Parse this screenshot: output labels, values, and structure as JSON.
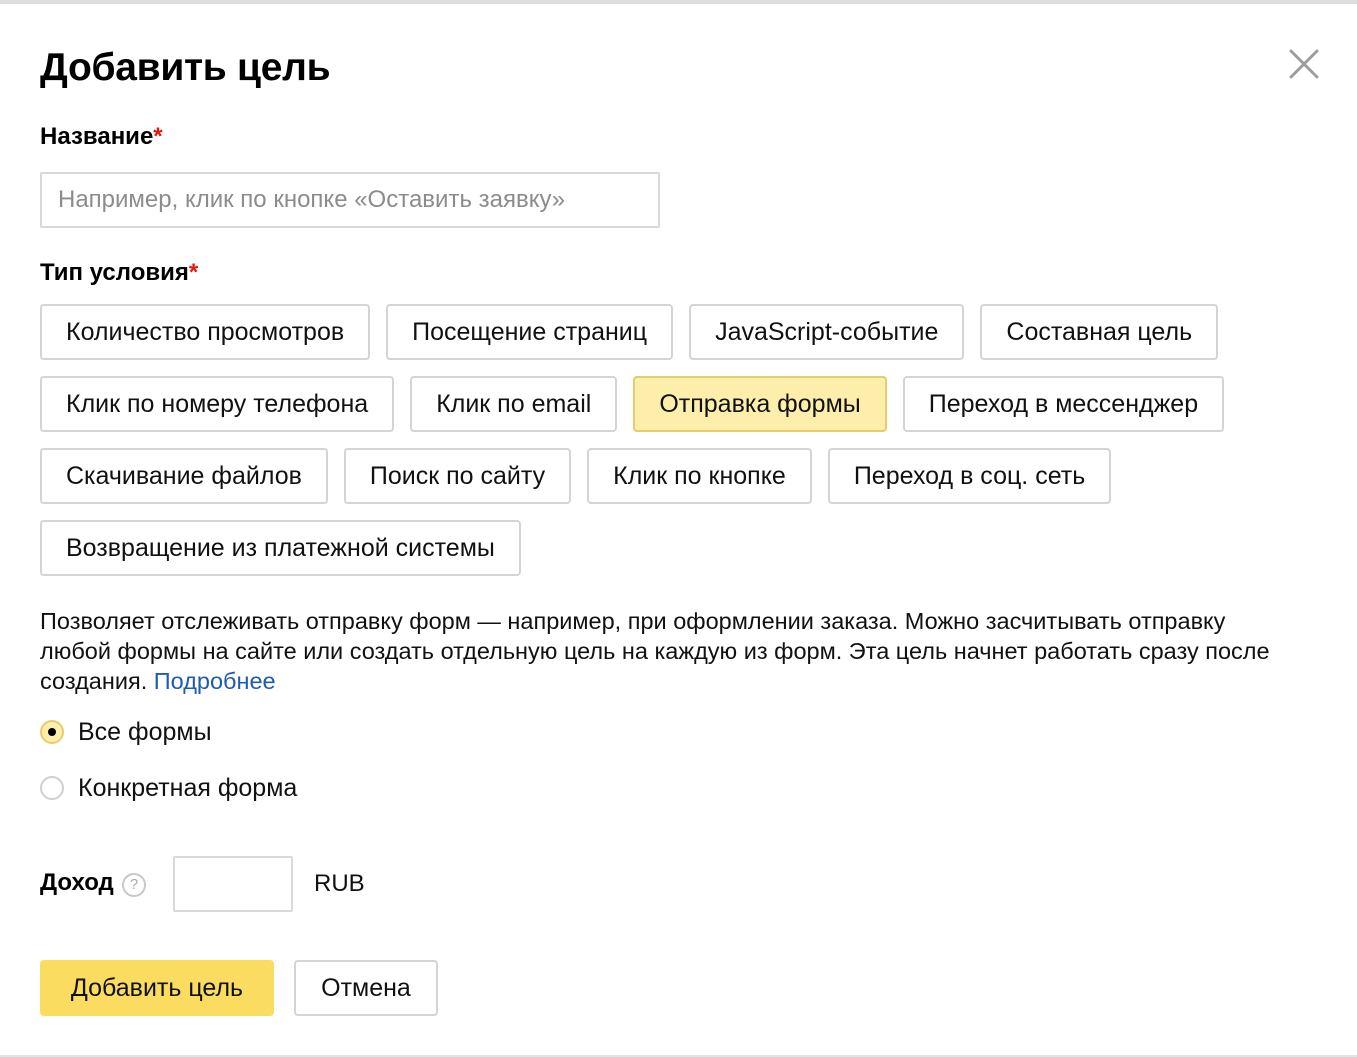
{
  "dialog": {
    "title": "Добавить цель",
    "close_icon": "close-icon"
  },
  "name_field": {
    "label": "Название",
    "required_mark": "*",
    "value": "",
    "placeholder": "Например, клик по кнопке «Оставить заявку»"
  },
  "condition_type": {
    "label": "Тип условия",
    "required_mark": "*",
    "selected": "Отправка формы",
    "rows": [
      [
        "Количество просмотров",
        "Посещение страниц",
        "JavaScript-событие",
        "Составная цель"
      ],
      [
        "Клик по номеру телефона",
        "Клик по email",
        "Отправка формы",
        "Переход в мессенджер"
      ],
      [
        "Скачивание файлов",
        "Поиск по сайту",
        "Клик по кнопке",
        "Переход в соц. сеть"
      ],
      [
        "Возвращение из платежной системы"
      ]
    ]
  },
  "description": {
    "text": "Позволяет отслеживать отправку форм — например, при оформлении заказа. Можно засчитывать отправку любой формы на сайте или создать отдельную цель на каждую из форм. Эта цель начнет работать сразу после создания. ",
    "link_text": "Подробнее"
  },
  "form_scope": {
    "options": [
      {
        "label": "Все формы",
        "checked": true
      },
      {
        "label": "Конкретная форма",
        "checked": false
      }
    ]
  },
  "income": {
    "label": "Доход",
    "help_glyph": "?",
    "help_icon": "question-circle-icon",
    "value": "",
    "currency": "RUB"
  },
  "actions": {
    "submit_label": "Добавить цель",
    "cancel_label": "Отмена"
  },
  "colors": {
    "accent_yellow": "#fadd60",
    "selected_bg": "#fdeeab",
    "required_red": "#e0190e",
    "link_blue": "#1f5bb3"
  }
}
